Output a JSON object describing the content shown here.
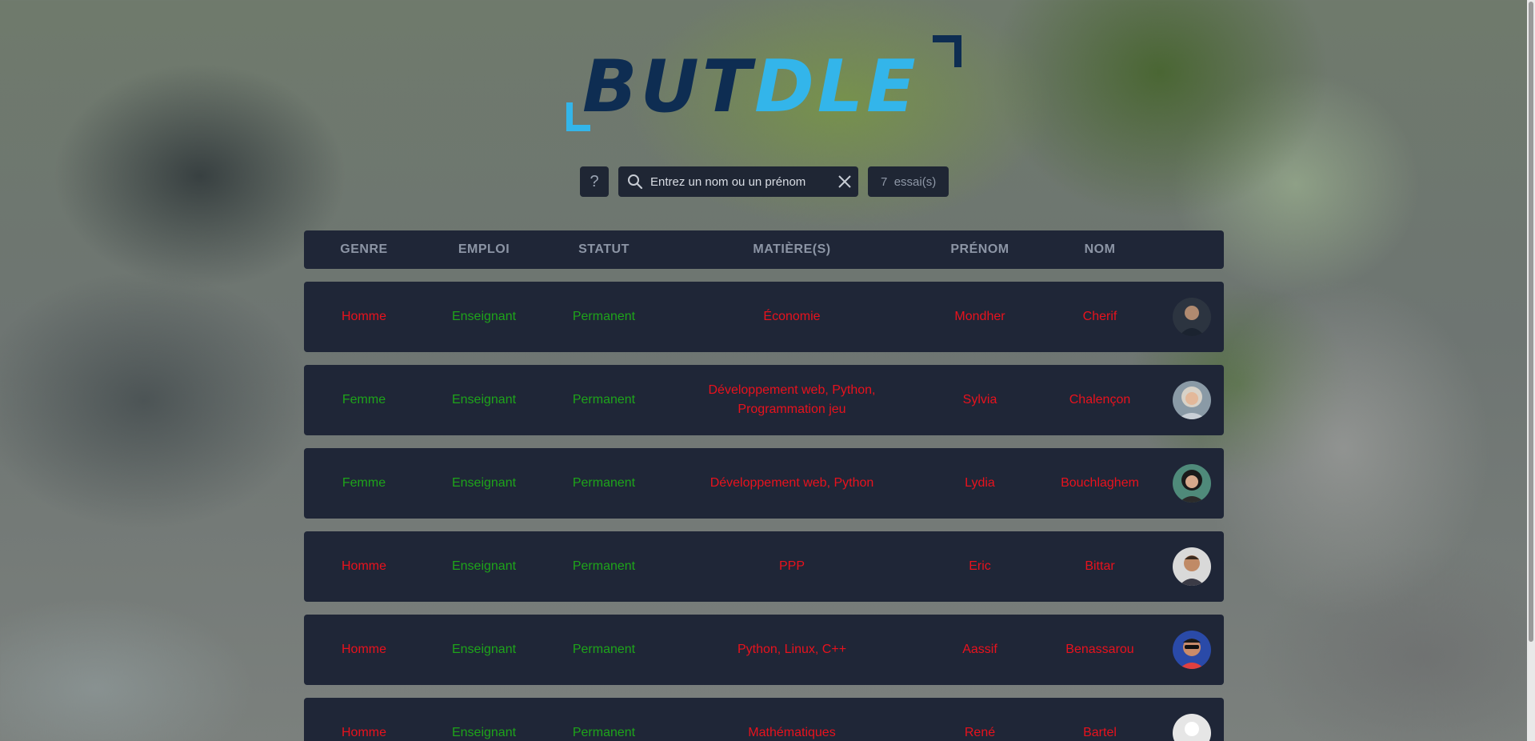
{
  "app": {
    "logo_part1": "BUT",
    "logo_part2": "DLE"
  },
  "toolbar": {
    "help_label": "?",
    "search_placeholder": "Entrez un nom ou un prénom",
    "tries_count": "7",
    "tries_label": "essai(s)"
  },
  "columns": [
    "GENRE",
    "EMPLOI",
    "STATUT",
    "MATIÈRE(S)",
    "PRÉNOM",
    "NOM"
  ],
  "colors": {
    "correct": "#1ea41a",
    "incorrect": "#e8121d",
    "panel": "#1f2637"
  },
  "rows": [
    {
      "genre": "Homme",
      "emploi": "Enseignant",
      "statut": "Permanent",
      "matiere": "Économie",
      "prenom": "Mondher",
      "nom": "Cherif",
      "genre_ok": false,
      "emploi_ok": true,
      "statut_ok": true,
      "matiere_ok": false,
      "prenom_ok": false,
      "nom_ok": false
    },
    {
      "genre": "Femme",
      "emploi": "Enseignant",
      "statut": "Permanent",
      "matiere": "Développement web, Python, Programmation jeu",
      "prenom": "Sylvia",
      "nom": "Chalençon",
      "genre_ok": true,
      "emploi_ok": true,
      "statut_ok": true,
      "matiere_ok": false,
      "prenom_ok": false,
      "nom_ok": false
    },
    {
      "genre": "Femme",
      "emploi": "Enseignant",
      "statut": "Permanent",
      "matiere": "Développement web, Python",
      "prenom": "Lydia",
      "nom": "Bouchlaghem",
      "genre_ok": true,
      "emploi_ok": true,
      "statut_ok": true,
      "matiere_ok": false,
      "prenom_ok": false,
      "nom_ok": false
    },
    {
      "genre": "Homme",
      "emploi": "Enseignant",
      "statut": "Permanent",
      "matiere": "PPP",
      "prenom": "Eric",
      "nom": "Bittar",
      "genre_ok": false,
      "emploi_ok": true,
      "statut_ok": true,
      "matiere_ok": false,
      "prenom_ok": false,
      "nom_ok": false
    },
    {
      "genre": "Homme",
      "emploi": "Enseignant",
      "statut": "Permanent",
      "matiere": "Python, Linux, C++",
      "prenom": "Aassif",
      "nom": "Benassarou",
      "genre_ok": false,
      "emploi_ok": true,
      "statut_ok": true,
      "matiere_ok": false,
      "prenom_ok": false,
      "nom_ok": false
    },
    {
      "genre": "Homme",
      "emploi": "Enseignant",
      "statut": "Permanent",
      "matiere": "Mathématiques",
      "prenom": "René",
      "nom": "Bartel",
      "genre_ok": false,
      "emploi_ok": true,
      "statut_ok": true,
      "matiere_ok": false,
      "prenom_ok": false,
      "nom_ok": false
    }
  ]
}
